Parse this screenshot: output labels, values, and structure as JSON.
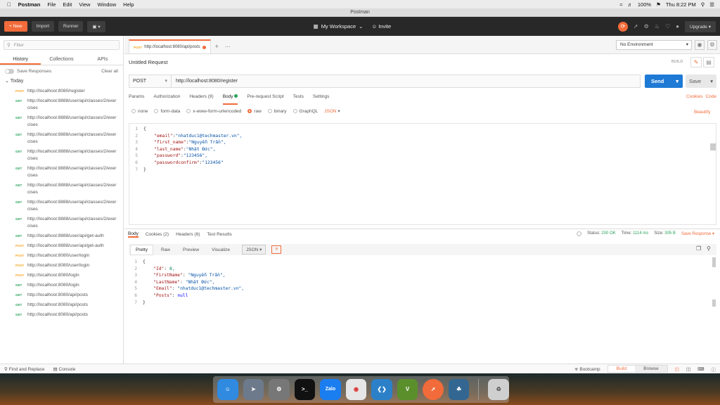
{
  "menubar": {
    "app": "Postman",
    "items": [
      "File",
      "Edit",
      "View",
      "Window",
      "Help"
    ],
    "battery": "100%",
    "clock": "Thu 8:22 PM"
  },
  "window": {
    "title": "Postman"
  },
  "header": {
    "new_label": "New",
    "import_label": "Import",
    "runner_label": "Runner",
    "workspace_label": "My Workspace",
    "invite_label": "Invite",
    "upgrade_label": "Upgrade"
  },
  "sidebar": {
    "filter_placeholder": "Filter",
    "tabs": [
      "History",
      "Collections",
      "APIs"
    ],
    "save_responses": "Save Responses",
    "clear_all": "Clear all",
    "group": "Today",
    "items": [
      {
        "method": "POST",
        "url": "http://localhost:8080/register"
      },
      {
        "method": "GET",
        "url": "http://localhost:8888/user/api/classes/2/exercises"
      },
      {
        "method": "GET",
        "url": "http://localhost:8888/user/api/classes/2/exercises"
      },
      {
        "method": "GET",
        "url": "http://localhost:8888/user/api/classes/2/exercises"
      },
      {
        "method": "GET",
        "url": "http://localhost:8888/user/api/classes/2/exercises"
      },
      {
        "method": "GET",
        "url": "http://localhost:8888/user/api/classes/2/exercises"
      },
      {
        "method": "GET",
        "url": "http://localhost:8888/user/api/classes/2/exercises"
      },
      {
        "method": "GET",
        "url": "http://localhost:8888/user/api/classes/2/exercises"
      },
      {
        "method": "GET",
        "url": "http://localhost:8888/user/api/classes/2/exercises"
      },
      {
        "method": "GET",
        "url": "http://localhost:8888/user/api/get-auth"
      },
      {
        "method": "POST",
        "url": "http://localhost:8888/user/api/get-auth"
      },
      {
        "method": "POST",
        "url": "http://localhost:8080/user/login"
      },
      {
        "method": "POST",
        "url": "http://localhost:8080/user/login"
      },
      {
        "method": "POST",
        "url": "http://localhost:8080/login"
      },
      {
        "method": "GET",
        "url": "http://localhost:8080/login"
      },
      {
        "method": "GET",
        "url": "http://localhost:8080/api/posts"
      },
      {
        "method": "GET",
        "url": "http://localhost:8080/api/posts"
      },
      {
        "method": "GET",
        "url": "http://localhost:8080/api/posts"
      }
    ]
  },
  "tabsbar": {
    "tab_method": "POST",
    "tab_url": "http://localhost:8080/api/posts",
    "environment": "No Environment"
  },
  "request": {
    "title": "Untitled Request",
    "build": "BUILD",
    "method": "POST",
    "url": "http://localhost:8080/register",
    "send": "Send",
    "save": "Save",
    "tabs": [
      "Params",
      "Authorization",
      "Headers (9)",
      "Body",
      "Pre-request Script",
      "Tests",
      "Settings"
    ],
    "cookies": "Cookies",
    "code": "Code",
    "body_options": [
      "none",
      "form-data",
      "x-www-form-urlencoded",
      "raw",
      "binary",
      "GraphQL"
    ],
    "body_format": "JSON",
    "beautify": "Beautify",
    "body_lines": [
      {
        "key": "",
        "value": "{"
      },
      {
        "key": "\"email\"",
        "value": "\"nhatduc1@techmaster.vn\","
      },
      {
        "key": "\"first_name\"",
        "value": "\"Nguyễn Trần\","
      },
      {
        "key": "\"last_name\"",
        "value": "\"Nhật Đức\","
      },
      {
        "key": "\"password\"",
        "value": "\"123456\","
      },
      {
        "key": "\"passwordconfirm\"",
        "value": "\"123456\""
      },
      {
        "key": "",
        "value": "}"
      }
    ]
  },
  "response": {
    "tabs": [
      "Body",
      "Cookies (2)",
      "Headers (6)",
      "Test Results"
    ],
    "status_label": "Status:",
    "status": "200 OK",
    "time_label": "Time:",
    "time": "1114 ms",
    "size_label": "Size:",
    "size": "305 B",
    "save_response": "Save Response",
    "view_tabs": [
      "Pretty",
      "Raw",
      "Preview",
      "Visualize"
    ],
    "format": "JSON",
    "lines": [
      {
        "key": "",
        "value": "{"
      },
      {
        "key": "\"Id\"",
        "value": "8,"
      },
      {
        "key": "\"FirstName\"",
        "value": "\"Nguyễn Trần\","
      },
      {
        "key": "\"LastName\"",
        "value": "\"Nhật Đức\","
      },
      {
        "key": "\"Email\"",
        "value": "\"nhatduc1@techmaster.vn\","
      },
      {
        "key": "\"Posts\"",
        "value": "null"
      },
      {
        "key": "",
        "value": "}"
      }
    ]
  },
  "statusbar": {
    "find_replace": "Find and Replace",
    "console": "Console",
    "bootcamp": "Bootcamp",
    "build": "Build",
    "browse": "Browse"
  },
  "dock": {
    "zalo": "Zalo"
  }
}
